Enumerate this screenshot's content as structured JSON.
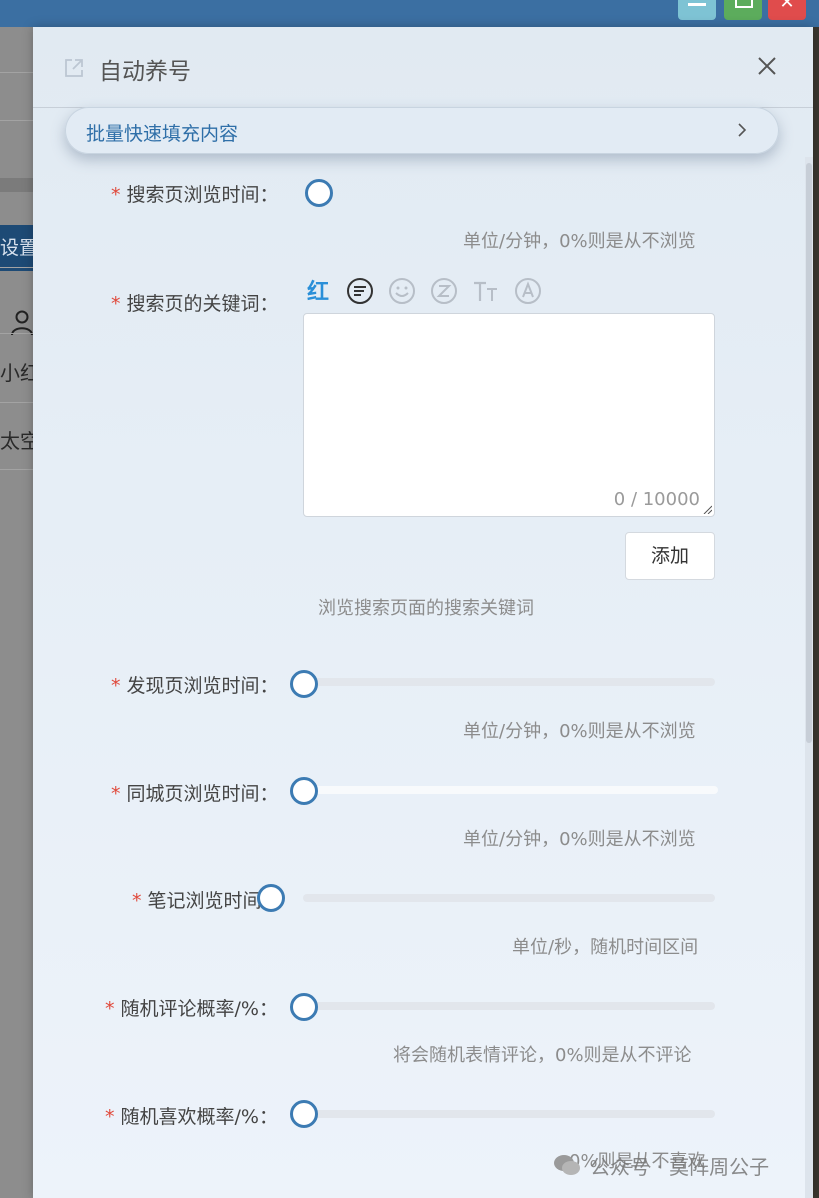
{
  "window": {
    "minimize_glyph": "",
    "close_glyph": "✕"
  },
  "background": {
    "setting_label": "设置",
    "row1_text": "小红",
    "row2_text": "太空"
  },
  "dialog": {
    "title": "自动养号",
    "collapse_label": "批量快速填充内容"
  },
  "fields": {
    "search_browse_time": {
      "label": "搜索页浏览时间：",
      "hint": "单位/分钟，0%则是从不浏览",
      "value": 0
    },
    "search_keywords": {
      "label": "搜索页的关键词：",
      "placeholder": "",
      "counter": "0 / 10000",
      "add_label": "添加",
      "hint": "浏览搜索页面的搜索关键词",
      "toolbar": [
        "xiaohongshu-red-icon",
        "list-icon",
        "smile-icon",
        "z-icon",
        "text-size-icon",
        "at-icon"
      ],
      "brand_glyph": "红"
    },
    "discover_browse_time": {
      "label": "发现页浏览时间：",
      "hint": "单位/分钟，0%则是从不浏览",
      "value": 0
    },
    "city_browse_time": {
      "label": "同城页浏览时间：",
      "hint": "单位/分钟，0%则是从不浏览",
      "value": 0
    },
    "note_browse_time": {
      "label": "笔记浏览时间：",
      "hint": "单位/秒，随机时间区间",
      "value": 0
    },
    "random_comment_rate": {
      "label": "随机评论概率/%：",
      "hint": "将会随机表情评论，0%则是从不评论",
      "value": 0
    },
    "random_like_rate": {
      "label": "随机喜欢概率/%：",
      "hint": "0%则是从不喜欢",
      "value": 0
    }
  },
  "watermark": "公众号 · 莫阵周公子",
  "colors": {
    "accent": "#3c7bb3",
    "required": "#e0483a",
    "topbar": "#3b6fa2"
  }
}
